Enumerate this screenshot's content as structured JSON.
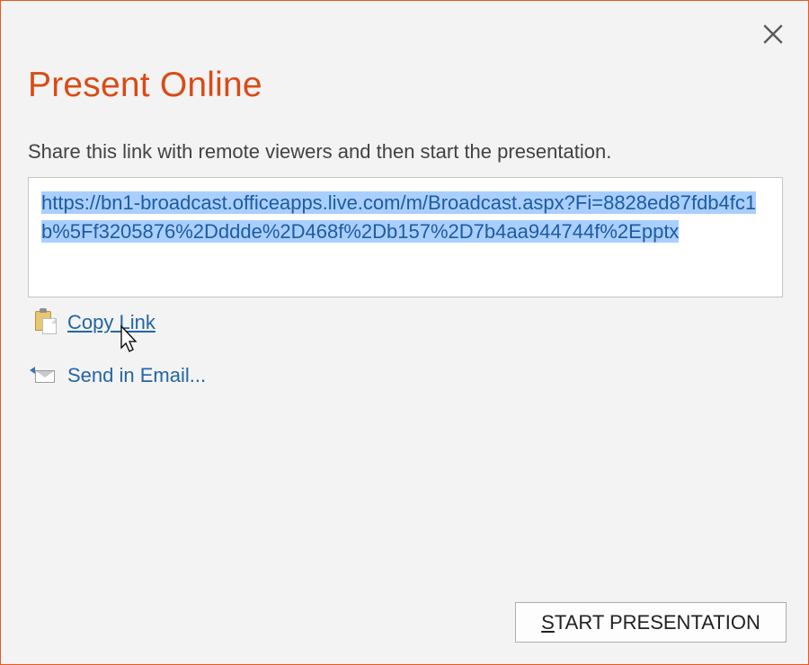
{
  "title": "Present Online",
  "instruction": "Share this link with remote viewers and then start the presentation.",
  "share_link": "https://bn1-broadcast.officeapps.live.com/m/Broadcast.aspx?Fi=8828ed87fdb4fc1b%5Ff3205876%2Dddde%2D468f%2Db157%2D7b4aa944744f%2Epptx",
  "copy_link_label": "Copy Link",
  "send_email_label": "Send in Email...",
  "start_button_letter": "S",
  "start_button_rest": "TART PRESENTATION"
}
